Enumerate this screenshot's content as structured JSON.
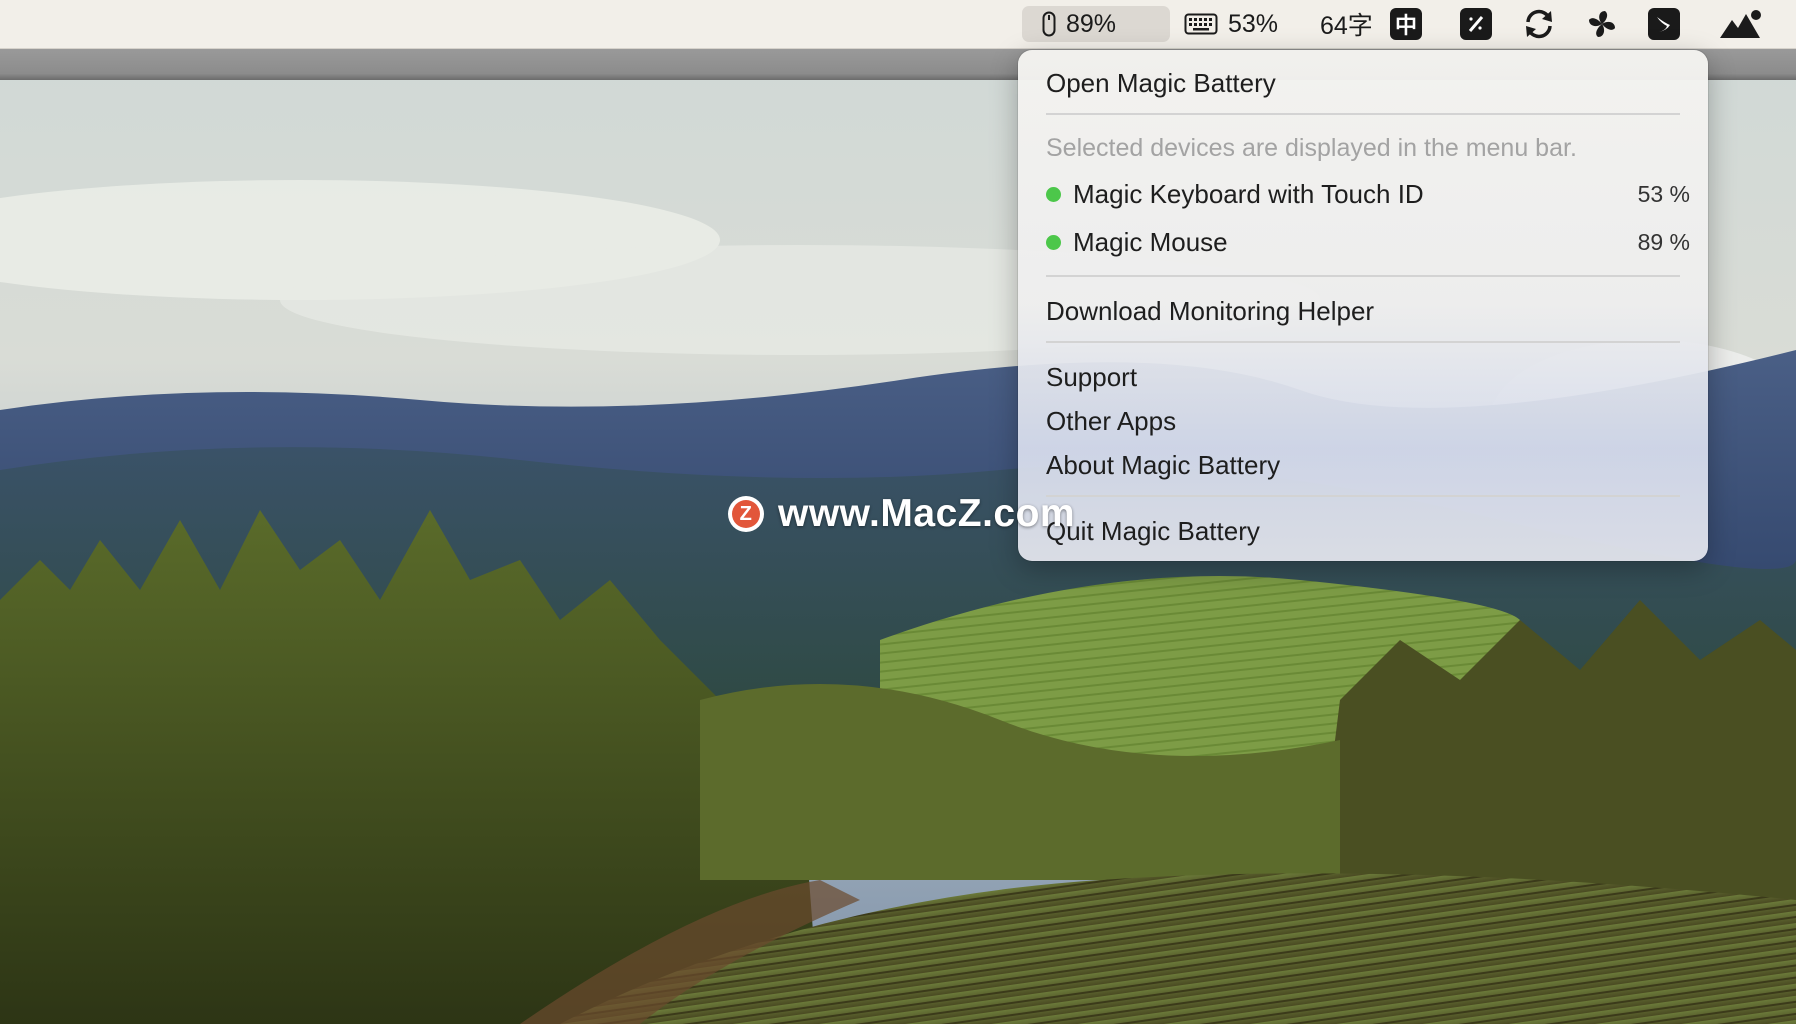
{
  "menubar": {
    "mouse_battery": "89%",
    "keyboard_battery": "53%",
    "word_count": "64字",
    "input_method": "中",
    "icons": [
      "mouse-icon",
      "keyboard-icon",
      "input-method-icon",
      "magic-wand-icon",
      "sync-icon",
      "pinwheel-icon",
      "swift-bird-icon",
      "mountain-icon"
    ]
  },
  "menu": {
    "open_label": "Open Magic Battery",
    "hint": "Selected devices are displayed in the menu bar.",
    "devices": [
      {
        "name": "Magic Keyboard with Touch ID",
        "percent": "53 %",
        "status_color": "#4cc74a"
      },
      {
        "name": "Magic Mouse",
        "percent": "89 %",
        "status_color": "#4cc74a"
      }
    ],
    "download_helper": "Download Monitoring Helper",
    "support": "Support",
    "other_apps": "Other Apps",
    "about": "About Magic Battery",
    "quit": "Quit Magic Battery"
  },
  "watermark": {
    "logo_letter": "Z",
    "text": "www.MacZ.com"
  }
}
